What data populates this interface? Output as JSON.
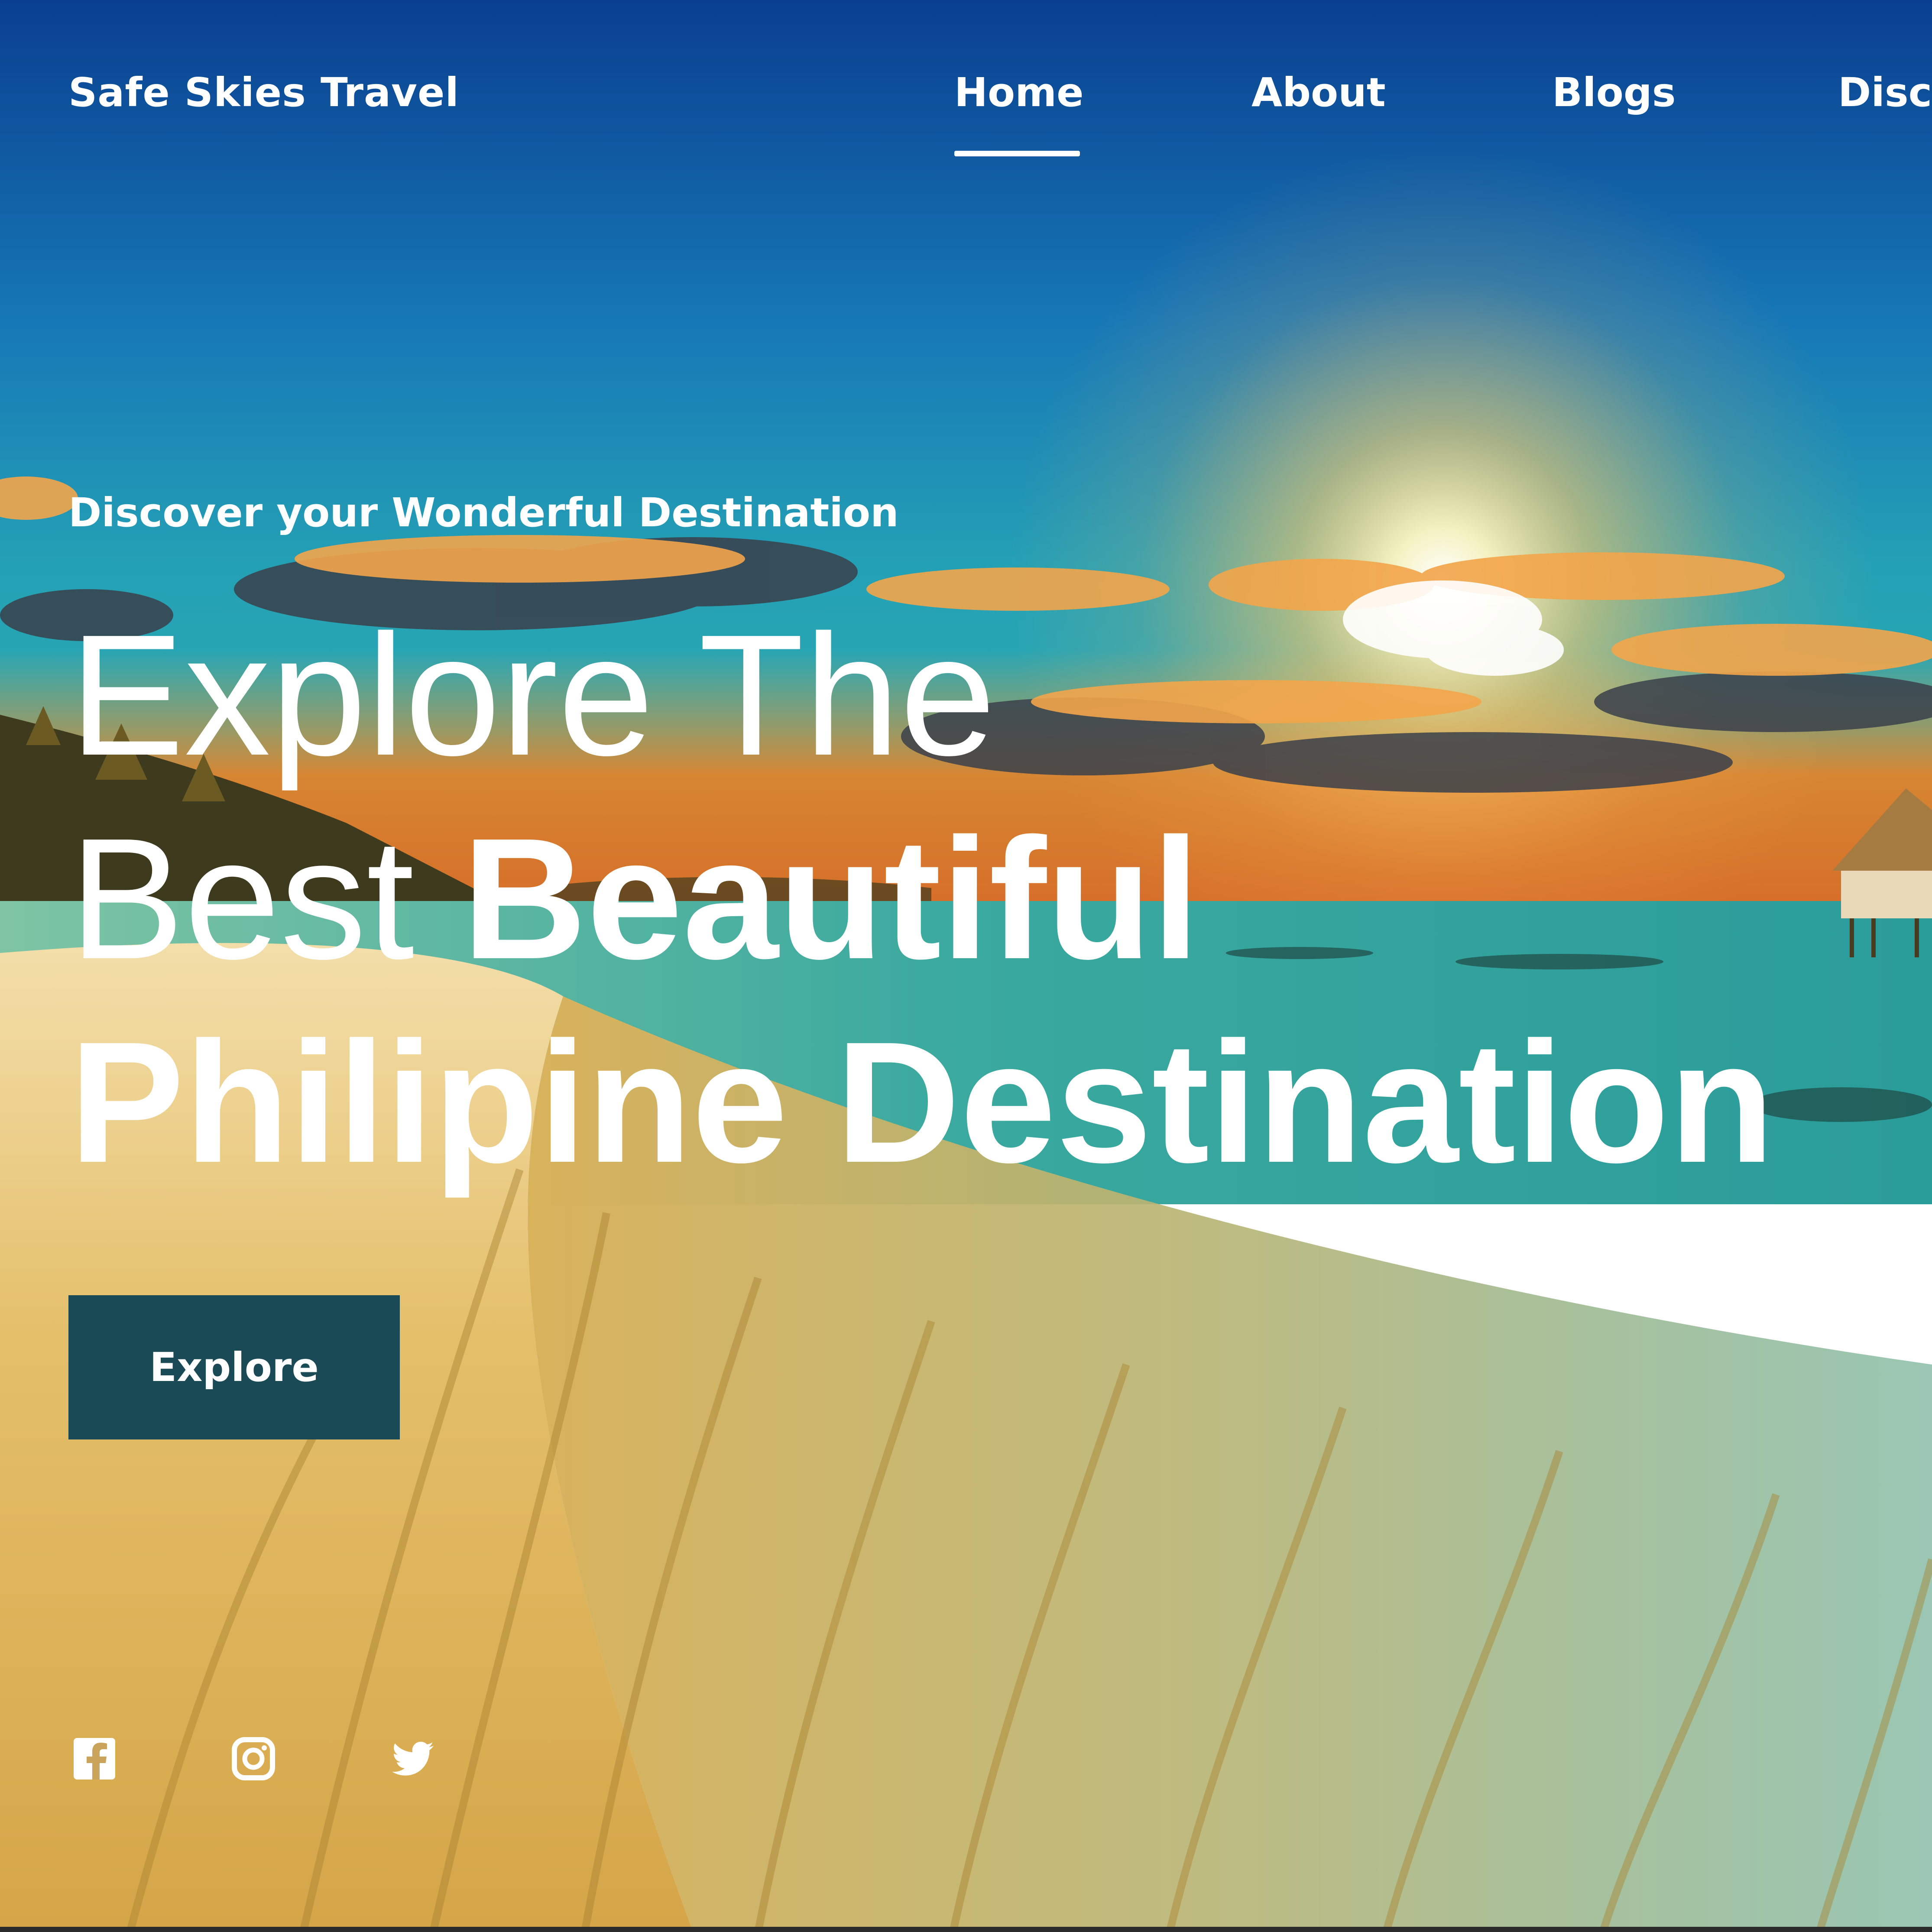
{
  "brand": {
    "name": "Safe Skies Travel"
  },
  "nav": {
    "items": [
      {
        "label": "Home",
        "active": true
      },
      {
        "label": "About"
      },
      {
        "label": "Blogs"
      },
      {
        "label": "Disco"
      }
    ]
  },
  "hero": {
    "tagline": "Discover your Wonderful Destination",
    "headline": {
      "line1": "Explore The",
      "line2_thin": "Best ",
      "line2_bold": "Beautiful",
      "line3_bold": "Philipine Destination"
    },
    "cta_label": "Explore"
  },
  "social": {
    "icons": [
      "facebook-icon",
      "instagram-icon",
      "twitter-icon"
    ]
  },
  "colors": {
    "cta_background": "#1b4a57",
    "text": "#ffffff",
    "sky_top": "#0a3f8f",
    "sea": "#3aa7a0",
    "sand": "#d9b25c",
    "sunset": "#f28a1e"
  }
}
